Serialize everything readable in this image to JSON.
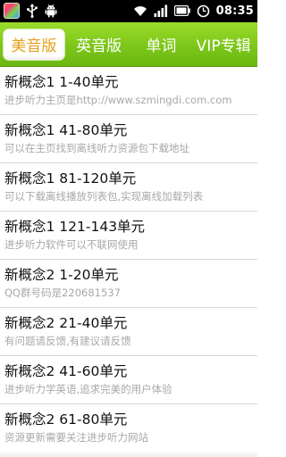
{
  "status_bar": {
    "time": "08:35",
    "icons": [
      "app-icon",
      "usb-icon",
      "android-icon",
      "wifi-icon",
      "signal-icon",
      "battery-icon",
      "alarm-icon"
    ]
  },
  "tabs": [
    {
      "label": "美音版",
      "active": true
    },
    {
      "label": "英音版",
      "active": false
    },
    {
      "label": "单词",
      "active": false
    },
    {
      "label": "VIP专辑",
      "active": false
    }
  ],
  "list": [
    {
      "title": "新概念1 1-40单元",
      "subtitle": "进步听力主页是http://www.szmingdi.com.com"
    },
    {
      "title": "新概念1 41-80单元",
      "subtitle": "可以在主页找到离线听力资源包下载地址"
    },
    {
      "title": "新概念1 81-120单元",
      "subtitle": "可以下载离线播放列表包,实现离线加载列表"
    },
    {
      "title": "新概念1 121-143单元",
      "subtitle": "进步听力软件可以不联网使用"
    },
    {
      "title": "新概念2 1-20单元",
      "subtitle": "QQ群号码是220681537"
    },
    {
      "title": "新概念2 21-40单元",
      "subtitle": "有问题请反馈,有建议请反馈"
    },
    {
      "title": "新概念2 41-60单元",
      "subtitle": "进步听力学英语,追求完美的用户体验"
    },
    {
      "title": "新概念2 61-80单元",
      "subtitle": "资源更新需要关注进步听力网站"
    }
  ],
  "colors": {
    "tab_bar_green": "#7cc61a",
    "active_tab_text": "#e6a21a",
    "title_text": "#111111",
    "subtitle_text": "#a8a8a8"
  }
}
